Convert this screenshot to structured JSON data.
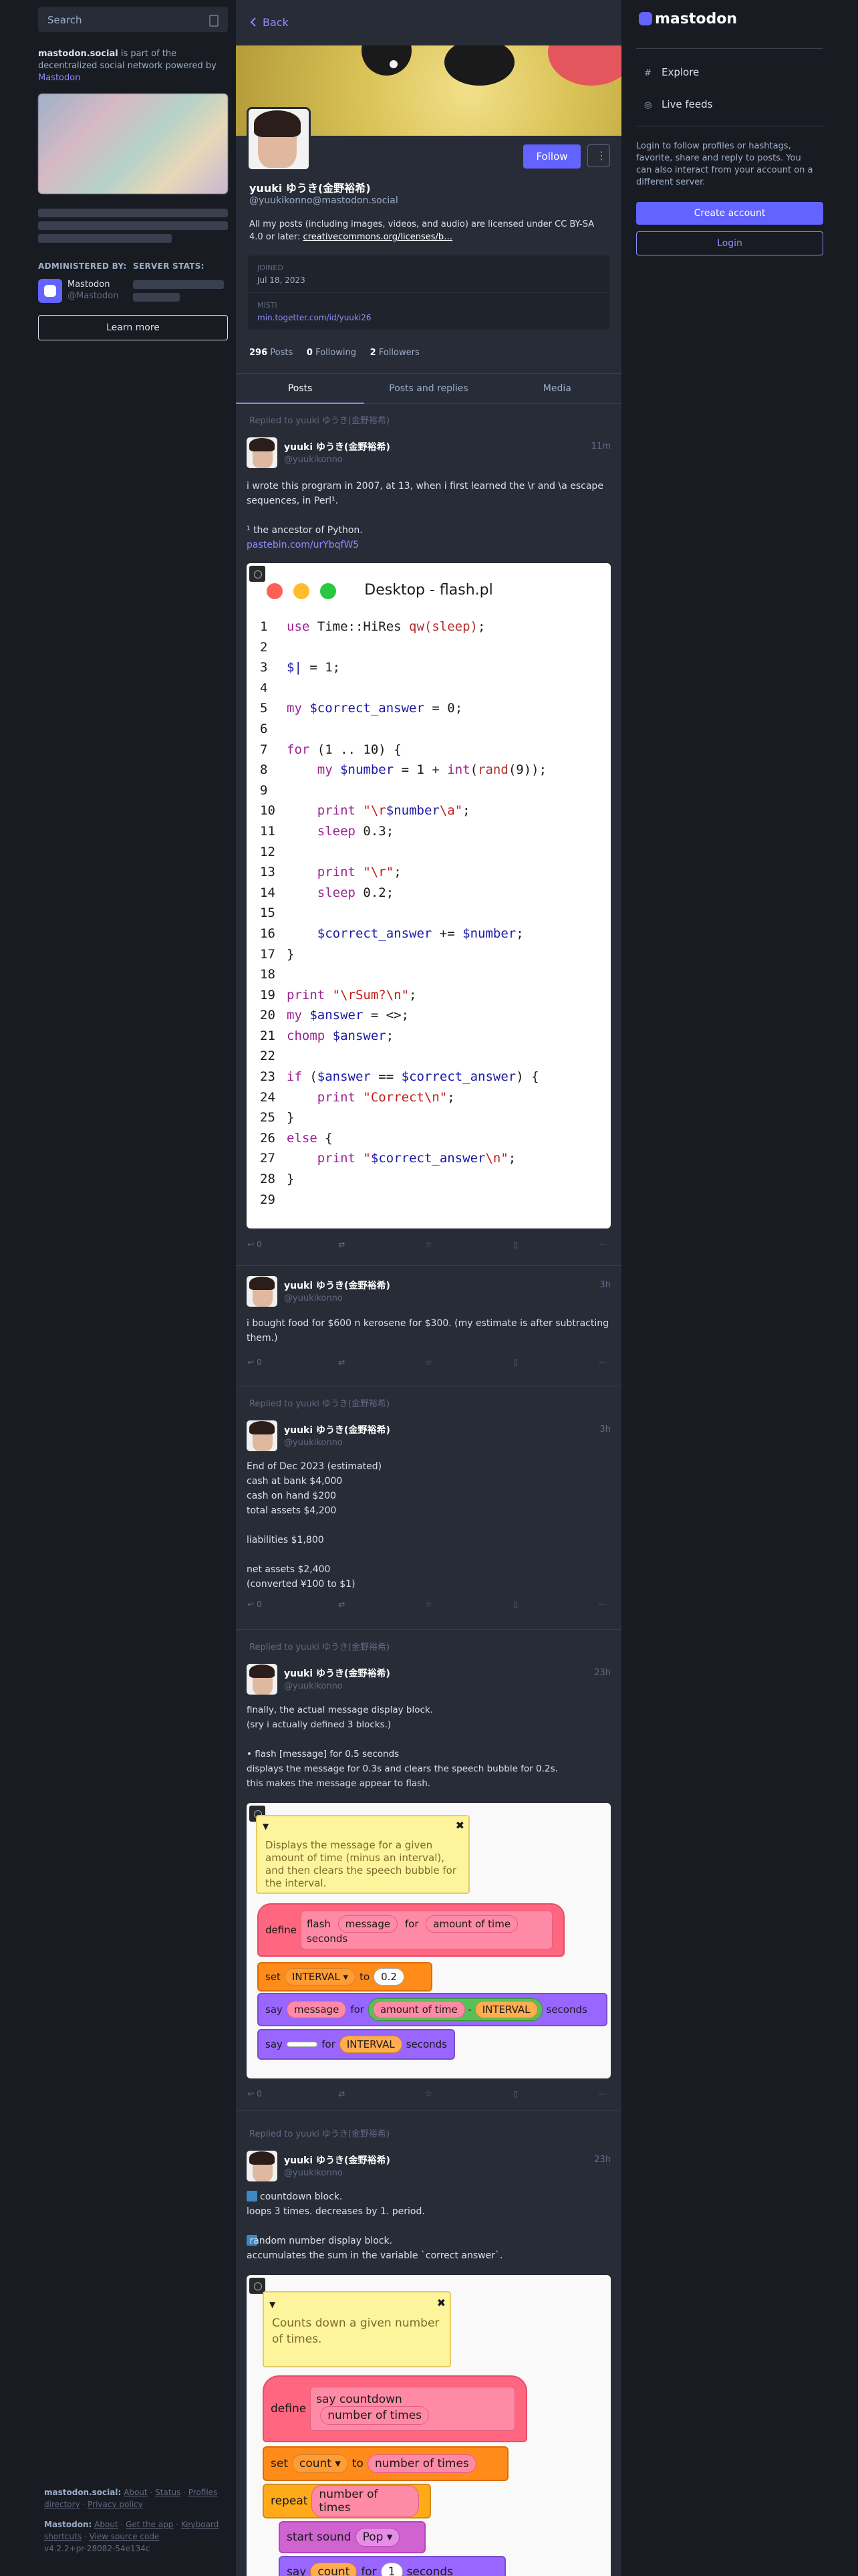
{
  "search": {
    "placeholder": "Search"
  },
  "server": {
    "domain": "mastodon.social",
    "about_mid": " is part of the decentralized social network powered by ",
    "about_link": "Mastodon",
    "administered_by": "ADMINISTERED BY:",
    "server_stats": "SERVER STATS:",
    "admin_name": "Mastodon",
    "admin_handle": "@Mastodon",
    "learn_more": "Learn more"
  },
  "left_footer": {
    "line1_server": "mastodon.social:",
    "line1_links": [
      "About",
      "Status",
      "Profiles directory",
      "Privacy policy"
    ],
    "line2_mastodon": "Mastodon:",
    "line2_links": [
      "About",
      "Get the app",
      "Keyboard shortcuts",
      "View source code"
    ],
    "version": "v4.2.2+pr-28082-54e134c"
  },
  "center": {
    "back": "Back",
    "profile": {
      "name": "yuuki ゆうき(金野裕希)",
      "handle": "@yuukikonno@mastodon.social",
      "follow": "Follow",
      "bio_text": "All my posts (including images, videos, and audio) are licensed under CC BY-SA 4.0 or later: ",
      "bio_link": "creativecommons.org/licenses/b…",
      "fields": [
        {
          "key": "JOINED",
          "value": "Jul 18, 2023"
        },
        {
          "key": "MISTI",
          "value": "min.togetter.com/id/yuuki26"
        }
      ],
      "posts_count": "296",
      "posts_label": " Posts",
      "following_count": "0",
      "following_label": " Following",
      "followers_count": "2",
      "followers_label": " Followers"
    },
    "tabs": [
      "Posts",
      "Posts and replies",
      "Media"
    ],
    "posts": [
      {
        "replied": "Replied to yuuki ゆうき(金野裕希)",
        "name": "yuuki ゆうき(金野裕希)",
        "handle": "@yuukikonno",
        "time": "11m",
        "text": "i wrote this program in 2007, at 13, when i first learned the \\r and \\a escape sequences, in Perl¹.\n\n¹ the ancestor of Python.",
        "link": "pastebin.com/urYbqfW5",
        "reply_count": "0"
      },
      {
        "name": "yuuki ゆうき(金野裕希)",
        "handle": "@yuukikonno",
        "time": "3h",
        "text": "i bought food for $600 n kerosene for $300. (my estimate is after subtracting them.)",
        "reply_count": "0"
      },
      {
        "replied": "Replied to yuuki ゆうき(金野裕希)",
        "name": "yuuki ゆうき(金野裕希)",
        "handle": "@yuukikonno",
        "time": "3h",
        "text": "End of Dec 2023 (estimated)\ncash at bank $4,000\ncash on hand $200\ntotal assets $4,200\n\nliabilities $1,800\n\nnet assets $2,400\n(converted ¥100 to $1)",
        "reply_count": "0"
      },
      {
        "replied": "Replied to yuuki ゆうき(金野裕希)",
        "name": "yuuki ゆうき(金野裕希)",
        "handle": "@yuukikonno",
        "time": "23h",
        "text": "finally, the actual message display block.\n(sry i actually defined 3 blocks.)\n\n• flash [message] for 0.5 seconds\ndisplays the message for 0.3s and clears the speech bubble for 0.2s.\nthis makes the message appear to flash.",
        "reply_count": "0"
      },
      {
        "replied": "Replied to yuuki ゆうき(金野裕希)",
        "name": "yuuki ゆうき(金野裕希)",
        "handle": "@yuukikonno",
        "time": "23h",
        "text": "countdown block.\nloops 3 times. decreases by 1. period.\n\n random number display block.\naccumulates the sum in the variable `correct answer`."
      }
    ],
    "code": {
      "window_title": "Desktop - flash.pl",
      "line_numbers": [
        "1",
        "2",
        "3",
        "4",
        "5",
        "6",
        "7",
        "8",
        "9",
        "10",
        "11",
        "12",
        "13",
        "14",
        "15",
        "16",
        "17",
        "18",
        "19",
        "20",
        "21",
        "22",
        "23",
        "24",
        "25",
        "26",
        "27",
        "28",
        "29"
      ]
    },
    "scratch1": {
      "note": "Displays the message for a given amount of time (minus an interval), and then clears the speech bubble for the interval.",
      "define": "define",
      "flash": "flash",
      "message": "message",
      "for": "for",
      "amount": "amount of time",
      "seconds": "seconds",
      "set": "set",
      "interval": "INTERVAL",
      "to": "to",
      "val": "0.2",
      "say": "say",
      "minus": "-"
    },
    "scratch2": {
      "note": "Counts down a given number of times.",
      "define": "define",
      "say_countdown": "say countdown",
      "number_of_times": "number of times",
      "set": "set",
      "count": "count",
      "to": "to",
      "repeat": "repeat",
      "start_sound": "start sound",
      "pop": "Pop",
      "say": "say",
      "for": "for",
      "one": "1",
      "seconds": "seconds"
    }
  },
  "right": {
    "logo": "mastodon",
    "nav": [
      "Explore",
      "Live feeds"
    ],
    "info": "Login to follow profiles or hashtags, favorite, share and reply to posts. You can also interact from your account on a different server.",
    "create": "Create account",
    "login": "Login"
  },
  "colors": {
    "accent": "#6364ff",
    "bg": "#191b22",
    "panel": "#282c37"
  }
}
